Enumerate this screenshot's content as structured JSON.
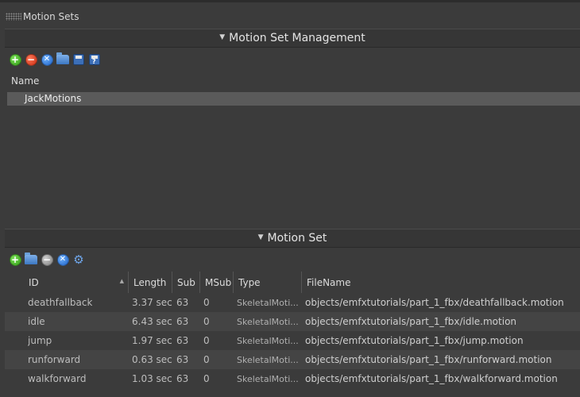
{
  "window": {
    "title": "Motion Sets"
  },
  "management": {
    "header": "Motion Set Management",
    "toolbar": [
      "add-icon",
      "remove-icon",
      "clear-icon",
      "open-folder-icon",
      "save-icon",
      "save-as-icon"
    ],
    "column_header": "Name",
    "items": [
      {
        "label": "JackMotions",
        "selected": true
      }
    ]
  },
  "motion_set": {
    "header": "Motion Set",
    "toolbar": [
      "add-icon",
      "open-folder-icon",
      "remove-icon",
      "clear-icon",
      "settings-icon"
    ],
    "columns": [
      "ID",
      "Length",
      "Sub",
      "MSub",
      "Type",
      "FileName"
    ],
    "rows": [
      {
        "id": "deathfallback",
        "length": "3.37 sec",
        "sub": "63",
        "msub": "0",
        "type": "SkeletalMoti...",
        "file": "objects/emfxtutorials/part_1_fbx/deathfallback.motion"
      },
      {
        "id": "idle",
        "length": "6.43 sec",
        "sub": "63",
        "msub": "0",
        "type": "SkeletalMoti...",
        "file": "objects/emfxtutorials/part_1_fbx/idle.motion"
      },
      {
        "id": "jump",
        "length": "1.97 sec",
        "sub": "63",
        "msub": "0",
        "type": "SkeletalMoti...",
        "file": "objects/emfxtutorials/part_1_fbx/jump.motion"
      },
      {
        "id": "runforward",
        "length": "0.63 sec",
        "sub": "63",
        "msub": "0",
        "type": "SkeletalMoti...",
        "file": "objects/emfxtutorials/part_1_fbx/runforward.motion"
      },
      {
        "id": "walkforward",
        "length": "1.03 sec",
        "sub": "63",
        "msub": "0",
        "type": "SkeletalMoti...",
        "file": "objects/emfxtutorials/part_1_fbx/walkforward.motion"
      }
    ]
  },
  "colors": {
    "background": "#3b3b3b",
    "selection": "#5a5a5a",
    "alt_row": "#444444"
  }
}
